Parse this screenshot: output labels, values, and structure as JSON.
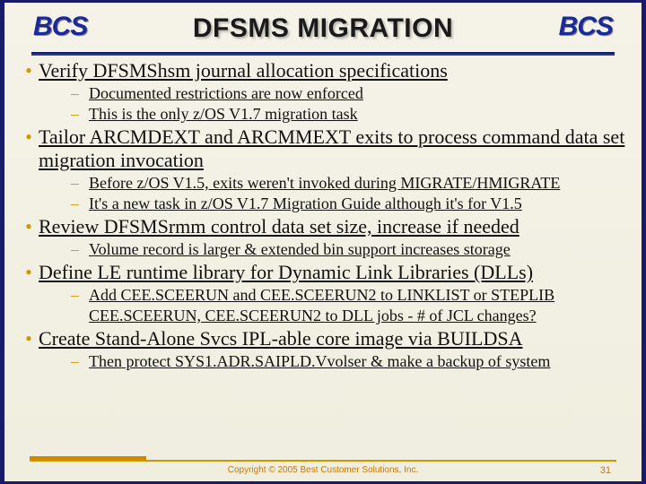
{
  "logo": "BCS",
  "title": "DFSMS MIGRATION",
  "items": [
    {
      "text": "Verify DFSMShsm journal allocation specifications",
      "sub": [
        "Documented restrictions are now enforced",
        "This is the only z/OS V1.7 migration task"
      ]
    },
    {
      "text": "Tailor ARCMDEXT and ARCMMEXT exits to process command data set migration invocation",
      "sub": [
        "Before z/OS V1.5, exits weren't invoked during MIGRATE/HMIGRATE",
        "It's a new task in z/OS V1.7 Migration Guide although it's for V1.5"
      ]
    },
    {
      "text": "Review DFSMSrmm control data set size, increase if needed",
      "sub": [
        "Volume record is larger & extended bin support increases storage"
      ]
    },
    {
      "text": "Define LE runtime library for Dynamic Link Libraries (DLLs)",
      "sub": [
        "Add CEE.SCEERUN and CEE.SCEERUN2 to LINKLIST or STEPLIB CEE.SCEERUN, CEE.SCEERUN2 to DLL jobs - # of JCL changes?"
      ]
    },
    {
      "text": "Create Stand-Alone Svcs IPL-able core image via BUILDSA",
      "sub": [
        "Then protect SYS1.ADR.SAIPLD.Vvolser & make a backup of system"
      ]
    }
  ],
  "footer": {
    "copyright": "Copyright © 2005 Best Customer Solutions, Inc.",
    "page": "31"
  }
}
